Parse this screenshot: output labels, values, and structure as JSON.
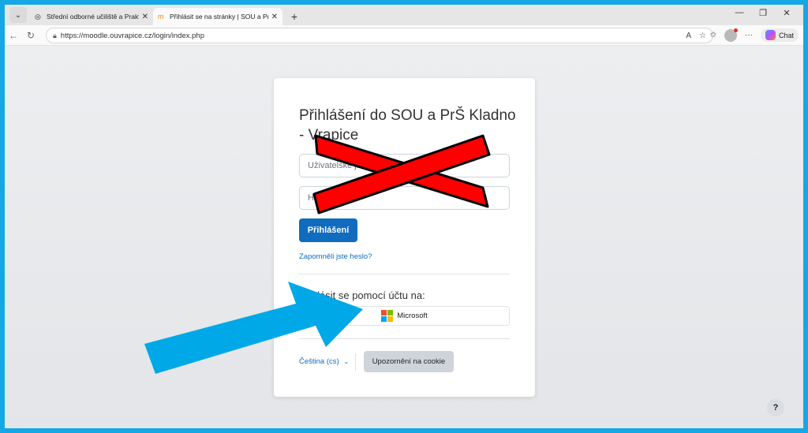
{
  "browser": {
    "tabs": [
      {
        "title": "Střední odborné učiliště a Praktick",
        "active": false
      },
      {
        "title": "Přihlásit se na stránky | SOU a PrŠ",
        "active": true
      }
    ],
    "url": "https://moodle.ouvrapice.cz/login/index.php",
    "chat_label": "Chat"
  },
  "login": {
    "heading": "Přihlášení do SOU a PrŠ Kladno - Vrapice",
    "username_placeholder": "Uživatelské jméno",
    "password_placeholder": "Heslo",
    "login_button": "Přihlášení",
    "forgot_link": "Zapomněli jste heslo?",
    "sso_label": "Přihlásit se pomocí účtu na:",
    "microsoft_button": "Microsoft",
    "language_selector": "Čeština (cs)",
    "cookie_button": "Upozornění na cookie"
  },
  "help_button": "?",
  "colors": {
    "primary": "#0f6cbf",
    "annotation_x": "#ff0000",
    "annotation_arrow": "#00a8e8",
    "frame_border": "#14a8e4"
  },
  "icons": [
    "tab-menu-icon",
    "back-icon",
    "reload-icon",
    "lock-icon",
    "favorite-icon",
    "collections-icon",
    "more-icon",
    "microsoft-logo-icon",
    "chevron-down-icon"
  ]
}
